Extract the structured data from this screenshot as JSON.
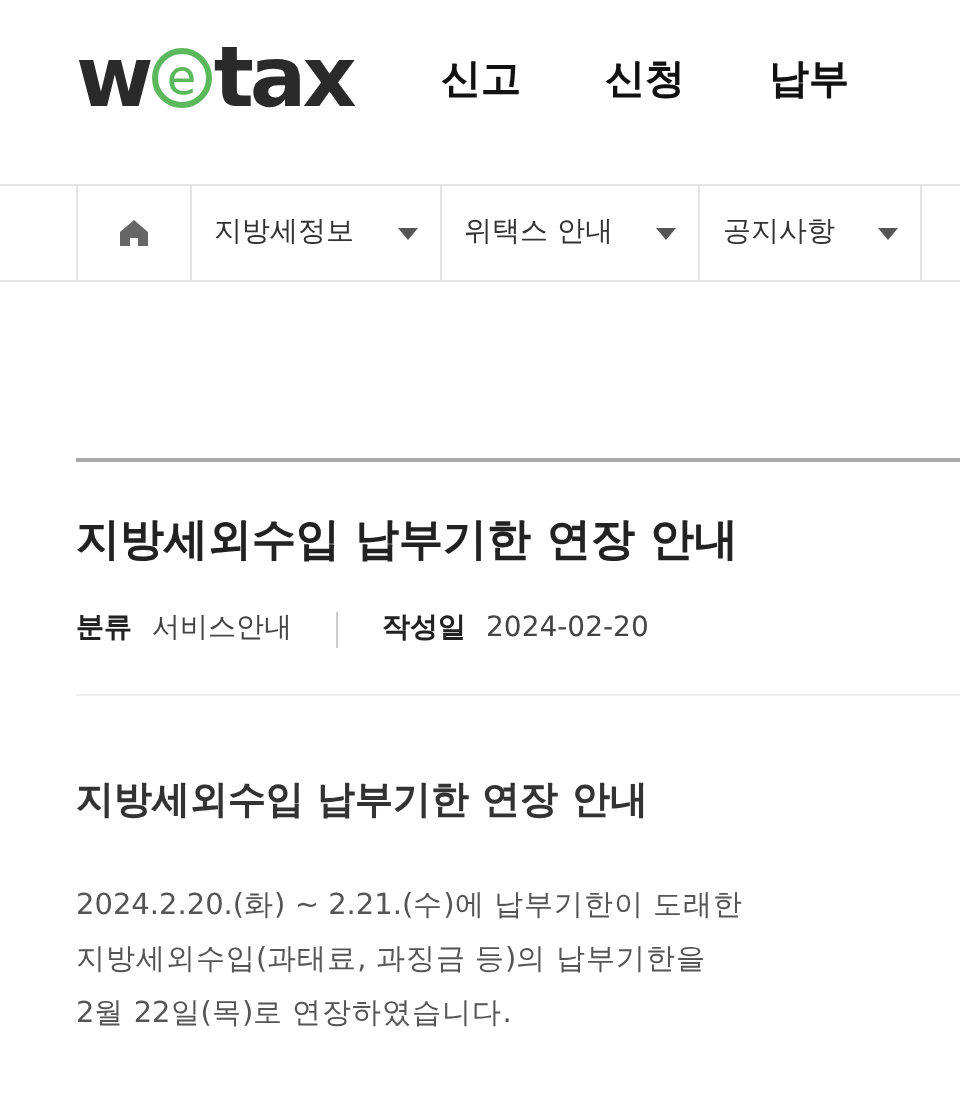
{
  "logo": {
    "before": "w",
    "mark": "e",
    "after": "tax"
  },
  "top_nav": [
    "신고",
    "신청",
    "납부"
  ],
  "breadcrumb": [
    {
      "label": "지방세정보"
    },
    {
      "label": "위택스 안내"
    },
    {
      "label": "공지사항"
    }
  ],
  "post": {
    "title": "지방세외수입 납부기한 연장 안내",
    "meta": [
      {
        "label": "분류",
        "value": "서비스안내"
      },
      {
        "label": "작성일",
        "value": "2024-02-20"
      }
    ],
    "subtitle": "지방세외수입 납부기한 연장 안내",
    "body": [
      "2024.2.20.(화) ~ 2.21.(수)에 납부기한이 도래한",
      "지방세외수입(과태료, 과징금 등)의 납부기한을",
      "2월 22일(목)로 연장하였습니다."
    ]
  }
}
